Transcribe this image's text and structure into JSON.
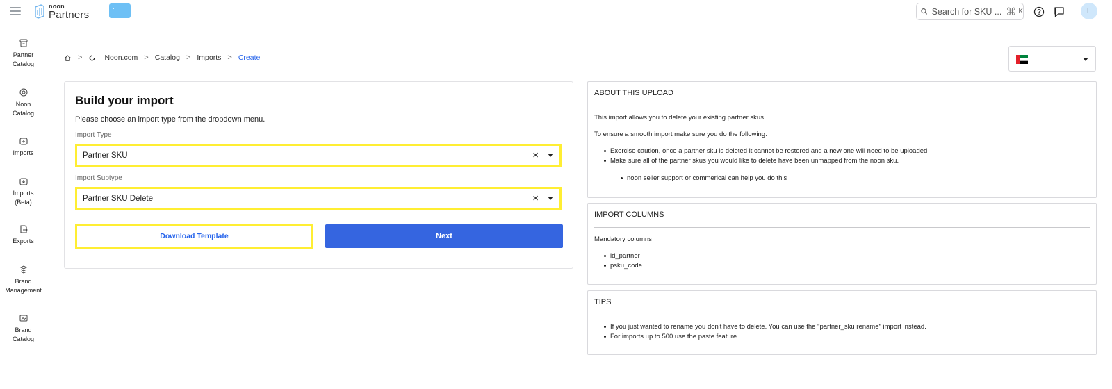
{
  "header": {
    "logo_small": "noon",
    "logo_big": "Partners",
    "search_placeholder": "Search for SKU ...",
    "search_shortcut_key": "K",
    "avatar_initial": "L",
    "icons": [
      "menu-icon",
      "search-icon",
      "command-icon",
      "help-icon",
      "feedback-icon"
    ]
  },
  "sidebar": {
    "items": [
      {
        "label_1": "Partner",
        "label_2": "Catalog",
        "icon": "partner-catalog-icon"
      },
      {
        "label_1": "Noon",
        "label_2": "Catalog",
        "icon": "noon-catalog-icon"
      },
      {
        "label_1": "Imports",
        "label_2": "",
        "icon": "imports-icon"
      },
      {
        "label_1": "Imports",
        "label_2": "(Beta)",
        "icon": "imports-beta-icon"
      },
      {
        "label_1": "Exports",
        "label_2": "",
        "icon": "exports-icon"
      },
      {
        "label_1": "Brand",
        "label_2": "Management",
        "icon": "brand-management-icon"
      },
      {
        "label_1": "Brand",
        "label_2": "Catalog",
        "icon": "brand-catalog-icon"
      }
    ]
  },
  "breadcrumb": {
    "items": [
      "Noon.com",
      "Catalog",
      "Imports"
    ],
    "current": "Create"
  },
  "build": {
    "title": "Build your import",
    "description": "Please choose an import type from the dropdown menu.",
    "import_type_label": "Import Type",
    "import_type_value": "Partner SKU",
    "import_subtype_label": "Import Subtype",
    "import_subtype_value": "Partner SKU Delete",
    "download_template_label": "Download Template",
    "next_label": "Next"
  },
  "about": {
    "title": "ABOUT THIS UPLOAD",
    "line_1": "This import allows you to delete your existing partner skus",
    "line_2": "To ensure a smooth import make sure you do the following:",
    "bullets": [
      "Exercise caution, once a partner sku is deleted it cannot be restored and a new one will need to be uploaded",
      "Make sure all of the partner skus you would like to delete have been unmapped from the noon sku."
    ],
    "sub_bullet": "noon seller support or commerical can help you do this"
  },
  "columns": {
    "title": "IMPORT COLUMNS",
    "subtitle": "Mandatory columns",
    "items": [
      "id_partner",
      "psku_code"
    ]
  },
  "tips": {
    "title": "TIPS",
    "items": [
      "If you just wanted to rename you don't have to delete. You can use the \"partner_sku rename\" import instead.",
      "For imports up to 500 use the paste feature"
    ]
  },
  "colors": {
    "accent": "#3565e0",
    "link": "#2563eb",
    "highlight": "#ffee33",
    "store_chip": "#6ec0f5"
  }
}
